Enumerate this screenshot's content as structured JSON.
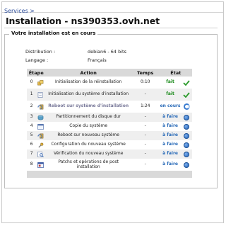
{
  "breadcrumb": {
    "services_label": "Services >"
  },
  "page": {
    "title": "Installation - ns390353.ovh.net"
  },
  "panel": {
    "legend": "Votre installation est en cours"
  },
  "info": {
    "distribution_label": "Distribution :",
    "distribution_value": "debian6 - 64 bits",
    "language_label": "Langage :",
    "language_value": "Français"
  },
  "table": {
    "headers": {
      "step": "Étape",
      "action": "Action",
      "time": "Temps",
      "state": "État"
    },
    "rows": [
      {
        "num": "0",
        "icon": "boxes-icon",
        "action": "Initialisation de la réinstallation",
        "time": "0:10",
        "state": "fait",
        "status": "done"
      },
      {
        "num": "1",
        "icon": "document-icon",
        "action": "Initialisation du système d'installation",
        "time": "-",
        "state": "fait",
        "status": "done"
      },
      {
        "num": "2",
        "icon": "reboot-icon",
        "action": "Reboot sur système d'installation",
        "time": "1:24",
        "state": "en cours",
        "status": "current"
      },
      {
        "num": "3",
        "icon": "disk-icon",
        "action": "Partitionnement du disque dur",
        "time": "-",
        "state": "à faire",
        "status": "todo"
      },
      {
        "num": "4",
        "icon": "copy-icon",
        "action": "Copie du système",
        "time": "-",
        "state": "à faire",
        "status": "todo"
      },
      {
        "num": "5",
        "icon": "reboot-icon",
        "action": "Reboot sur nouveau système",
        "time": "-",
        "state": "à faire",
        "status": "todo"
      },
      {
        "num": "6",
        "icon": "wrench-icon",
        "action": "Configuration du nouveau système",
        "time": "-",
        "state": "à faire",
        "status": "todo"
      },
      {
        "num": "7",
        "icon": "verify-icon",
        "action": "Vérification du nouveau système",
        "time": "-",
        "state": "à faire",
        "status": "todo"
      },
      {
        "num": "8",
        "icon": "window-icon",
        "action": "Patchs et opérations de post installation",
        "time": "-",
        "state": "à faire",
        "status": "todo"
      }
    ]
  }
}
